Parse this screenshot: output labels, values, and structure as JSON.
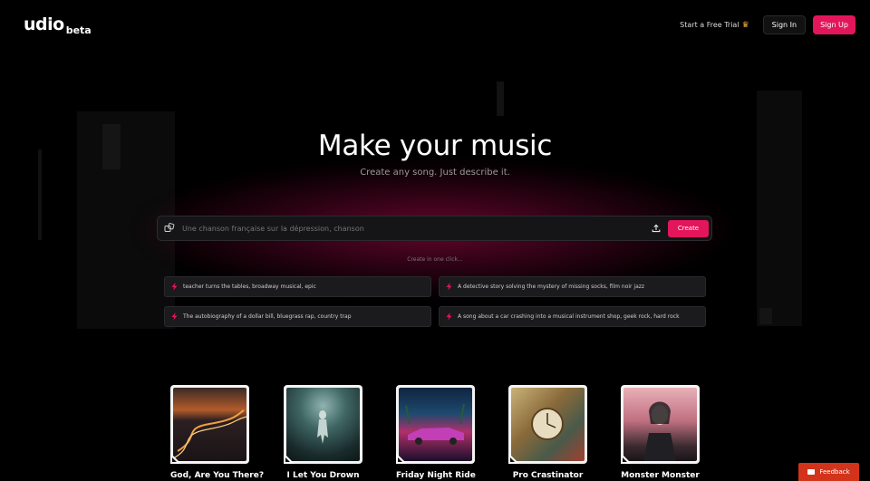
{
  "header": {
    "logo": "udio",
    "logo_badge": "beta",
    "trial_label": "Start a Free Trial",
    "sign_in": "Sign In",
    "sign_up": "Sign Up"
  },
  "hero": {
    "title": "Make your music",
    "subtitle": "Create any song. Just describe it.",
    "prompt_placeholder": "Une chanson française sur la dépression, chanson",
    "create_label": "Create",
    "one_click_label": "Create in one click..."
  },
  "suggestions": [
    "teacher turns the tables, broadway musical, epic",
    "A detective story solving the mystery of missing socks, film noir jazz",
    "The autobiography of a dollar bill, bluegrass rap, country trap",
    "A song about a car crashing into a musical instrument shop, geek rock, hard rock"
  ],
  "tracks": [
    {
      "title": "God, Are You There?"
    },
    {
      "title": "I Let You Drown"
    },
    {
      "title": "Friday Night Ride"
    },
    {
      "title": "Pro Crastinator"
    },
    {
      "title": "Monster Monster"
    }
  ],
  "feedback_label": "Feedback",
  "colors": {
    "accent": "#e3165b",
    "feedback": "#d3331b",
    "background": "#000000"
  }
}
